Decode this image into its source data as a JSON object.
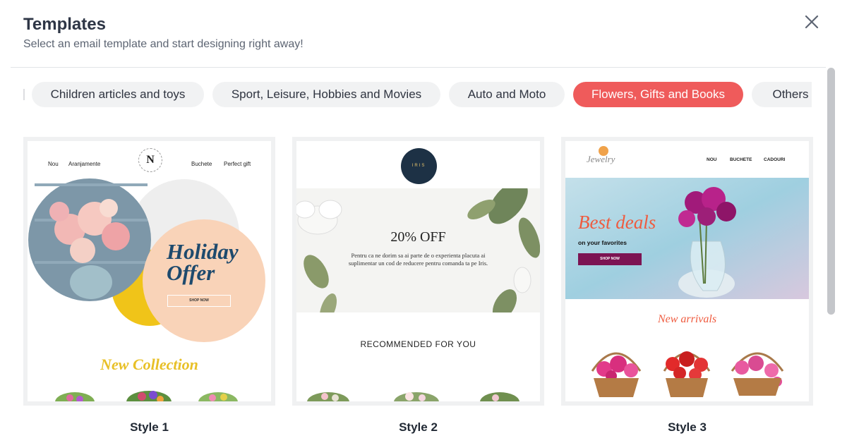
{
  "modal": {
    "title": "Templates",
    "subtitle": "Select an email template and start designing right away!",
    "close_label": "close"
  },
  "categories": [
    {
      "label": "Children articles and toys",
      "active": false
    },
    {
      "label": "Sport, Leisure, Hobbies and Movies",
      "active": false
    },
    {
      "label": "Auto and Moto",
      "active": false
    },
    {
      "label": "Flowers, Gifts and Books",
      "active": true
    },
    {
      "label": "Others",
      "active": false
    }
  ],
  "colors": {
    "accent": "#ef5b5b",
    "chip_bg": "#f1f2f3",
    "title": "#2e3646"
  },
  "templates": [
    {
      "label": "Style 1",
      "preview": {
        "nav_left": [
          "Nou",
          "Aranjamente"
        ],
        "nav_right": [
          "Buchete",
          "Perfect gift"
        ],
        "logo_letter": "N",
        "headline_line1": "Holiday",
        "headline_line2": "Offer",
        "button": "SHOP NOW",
        "section_title": "New Collection"
      }
    },
    {
      "label": "Style 2",
      "preview": {
        "logo_text": "IRIS",
        "headline": "20% OFF",
        "body": "Pentru ca ne dorim sa ai parte de o experienta placuta ai suplimentar un cod de reducere pentru comanda ta pe Iris.",
        "section_title": "RECOMMENDED FOR YOU"
      }
    },
    {
      "label": "Style 3",
      "preview": {
        "logo_text": "Jewelry",
        "nav": [
          "NOU",
          "BUCHETE",
          "CADOURI"
        ],
        "headline": "Best deals",
        "subheadline": "on your favorites",
        "button": "SHOP NOW",
        "section_title": "New arrivals"
      }
    }
  ]
}
